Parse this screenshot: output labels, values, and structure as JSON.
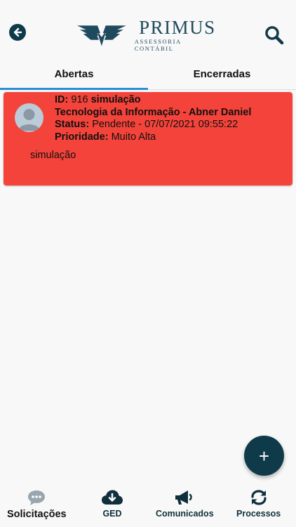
{
  "header": {
    "brand_name": "PRIMUS",
    "brand_sub": "ASSESSORIA CONTÁBIL"
  },
  "tabs": [
    {
      "label": "Abertas",
      "active": true
    },
    {
      "label": "Encerradas",
      "active": false
    }
  ],
  "card": {
    "id_label": "ID:",
    "id_value": "916",
    "title": "simulação",
    "department": "Tecnologia da Informação - Abner Daniel",
    "status_label": "Status:",
    "status_value": "Pendente - 07/07/2021 09:55:22",
    "priority_label": "Prioridade:",
    "priority_value": "Muito Alta",
    "description": "simulação",
    "color": "#f4433a"
  },
  "fab_label": "+",
  "nav": [
    {
      "label": "Solicitações",
      "icon": "chat-icon",
      "active": true
    },
    {
      "label": "GED",
      "icon": "cloud-download-icon",
      "active": false
    },
    {
      "label": "Comunicados",
      "icon": "megaphone-icon",
      "active": false
    },
    {
      "label": "Processos",
      "icon": "sync-icon",
      "active": false
    }
  ],
  "colors": {
    "primary": "#0e3a4a",
    "tab_indicator": "#2a8fd6"
  }
}
